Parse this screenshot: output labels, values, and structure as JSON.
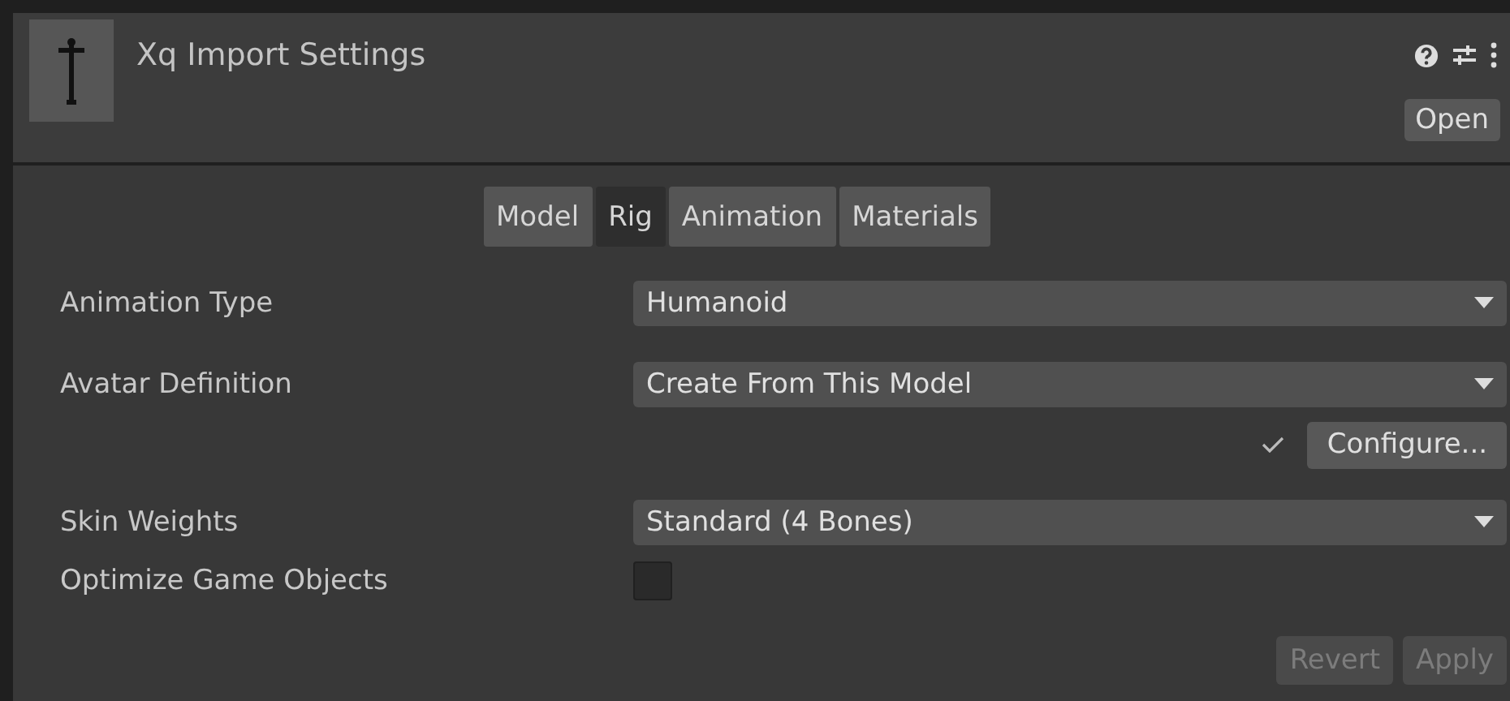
{
  "header": {
    "title": "Xq Import Settings",
    "open_button": "Open"
  },
  "tabs": [
    {
      "label": "Model",
      "selected": false
    },
    {
      "label": "Rig",
      "selected": true
    },
    {
      "label": "Animation",
      "selected": false
    },
    {
      "label": "Materials",
      "selected": false
    }
  ],
  "rows": [
    {
      "kind": "dropdown",
      "label": "Animation Type",
      "value": "Humanoid"
    },
    {
      "kind": "dropdown",
      "label": "Avatar Definition",
      "value": "Create From This Model"
    },
    {
      "kind": "button",
      "button": "Configure...",
      "checked": true
    },
    {
      "kind": "dropdown",
      "label": "Skin Weights",
      "value": "Standard (4 Bones)"
    },
    {
      "kind": "checkbox",
      "label": "Optimize Game Objects",
      "checked": false
    }
  ],
  "footer": [
    {
      "label": "Revert",
      "disabled": true
    },
    {
      "label": "Apply",
      "disabled": true
    }
  ]
}
